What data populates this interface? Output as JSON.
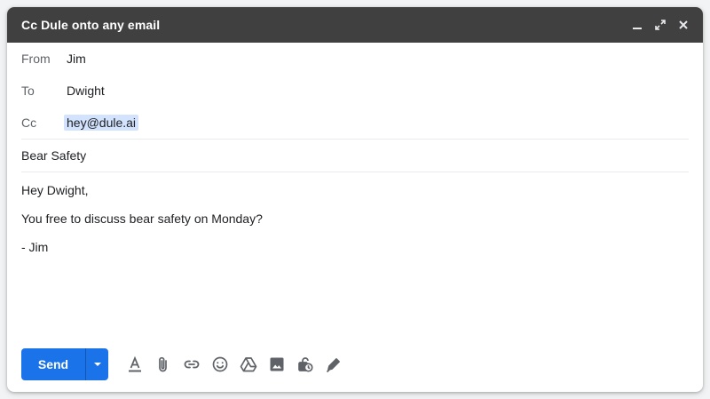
{
  "window": {
    "title": "Cc Dule onto any email",
    "controls": [
      "minimize-icon",
      "expand-icon",
      "close-icon"
    ]
  },
  "fields": {
    "from": {
      "label": "From",
      "value": "Jim"
    },
    "to": {
      "label": "To",
      "value": "Dwight"
    },
    "cc": {
      "label": "Cc",
      "value": "hey@dule.ai"
    }
  },
  "subject": "Bear Safety",
  "body": {
    "lines": [
      "Hey Dwight,",
      "You free to discuss bear safety on Monday?",
      "- Jim"
    ]
  },
  "toolbar": {
    "send_label": "Send",
    "icons": [
      "formatting-icon",
      "attach-icon",
      "link-icon",
      "emoji-icon",
      "drive-icon",
      "photo-icon",
      "confidential-icon",
      "signature-icon"
    ]
  },
  "colors": {
    "titlebar": "#404040",
    "send_button": "#1a73e8",
    "cc_chip": "#d3e3fd"
  }
}
